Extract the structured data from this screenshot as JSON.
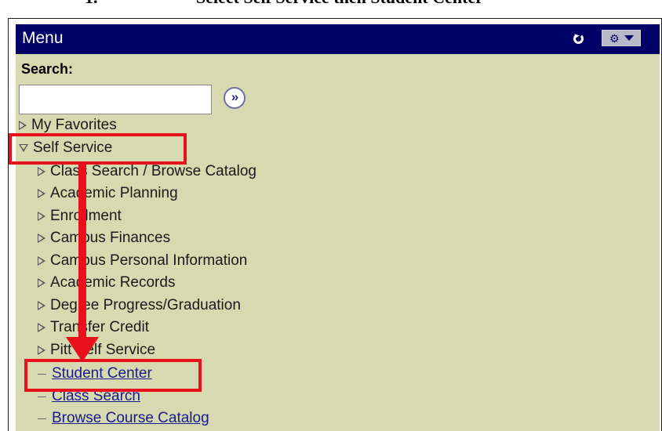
{
  "caption": {
    "number": "1.",
    "text": "Select Self Service then Student Center"
  },
  "menu": {
    "title": "Menu",
    "icons": {
      "refresh": "refresh-icon",
      "gear": "gear-icon",
      "dropdown": "chevron-down-icon"
    }
  },
  "search": {
    "label": "Search:",
    "value": "",
    "placeholder": "",
    "go_label": "»"
  },
  "tree": {
    "favorites": "My Favorites",
    "self_service": "Self Service",
    "items": [
      "Class Search / Browse Catalog",
      "Academic Planning",
      "Enrollment",
      "Campus Finances",
      "Campus Personal Information",
      "Academic Records",
      "Degree Progress/Graduation",
      "Transfer Credit",
      "Pitt Self Service"
    ],
    "links": [
      "Student Center",
      "Class Search",
      "Browse Course Catalog"
    ]
  },
  "colors": {
    "header_bg": "#000066",
    "body_bg": "#d7d9b0",
    "highlight": "#e8101a",
    "link": "#1a1a8c"
  }
}
